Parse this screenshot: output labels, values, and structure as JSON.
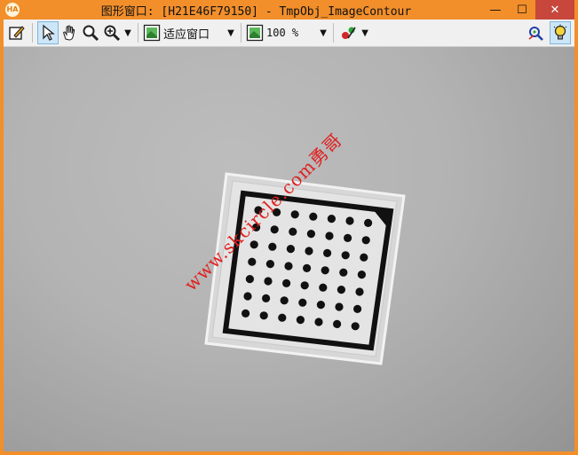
{
  "window": {
    "badge": "HA",
    "title": "图形窗口: [H21E46F79150] - TmpObj_ImageContour",
    "minimize": "—",
    "maximize": "☐",
    "close": "✕"
  },
  "toolbar": {
    "fit_label": "适应窗口",
    "zoom_value": "100 %",
    "dropdown_glyph": "▼"
  },
  "image": {
    "watermark": "www.skcircle.com勇哥",
    "grid": {
      "rows": 7,
      "cols": 7
    }
  },
  "colors": {
    "title_bar": "#f28f2b",
    "close_button": "#c7473d",
    "toolbar": "#f0f0f0",
    "watermark": "#e02020"
  }
}
